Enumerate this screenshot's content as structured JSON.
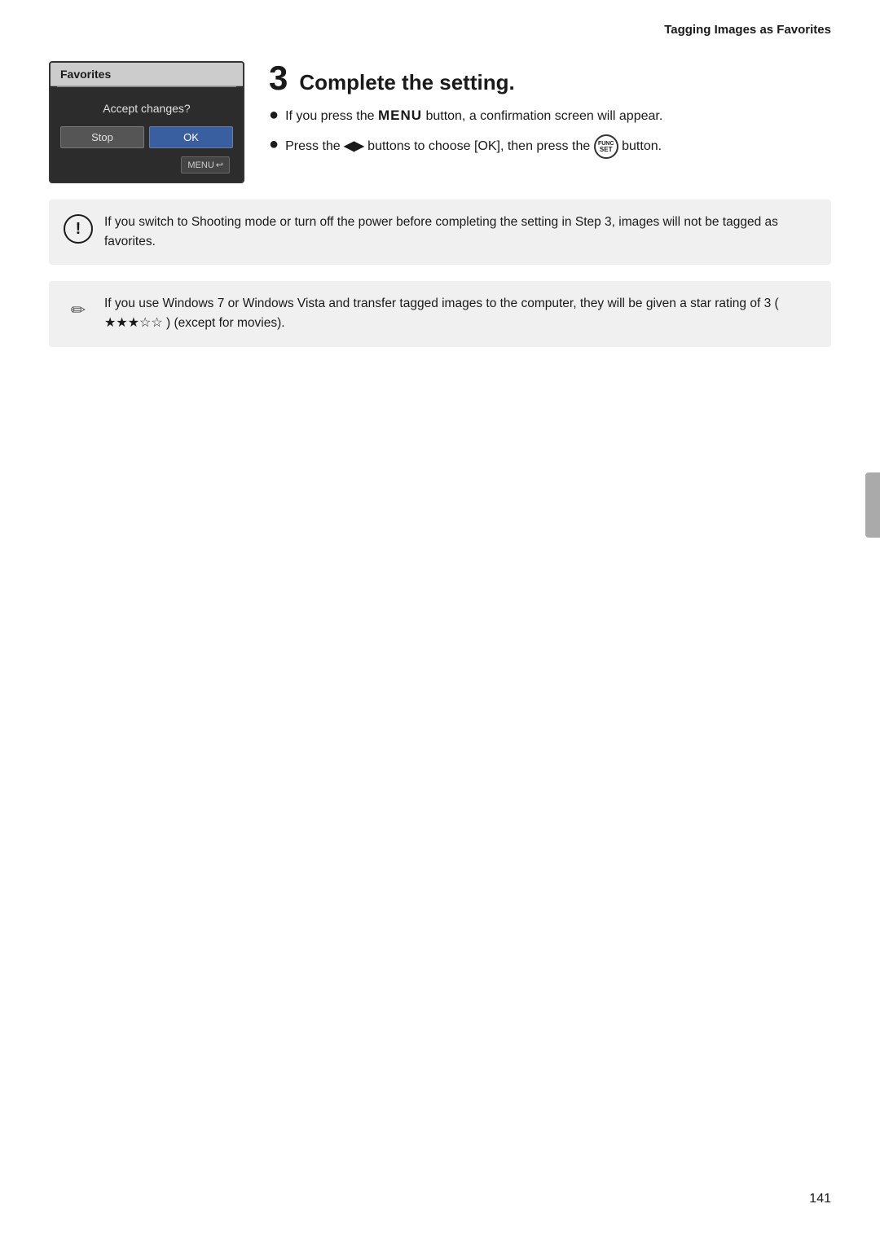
{
  "header": {
    "title": "Tagging Images as Favorites"
  },
  "step": {
    "number": "3",
    "title": "Complete the setting.",
    "bullets": [
      {
        "id": "bullet-1",
        "text_before": "If you press the ",
        "menu_label": "MENU",
        "text_after": " button, a confirmation screen will appear."
      },
      {
        "id": "bullet-2",
        "text_before": "Press the ",
        "arrow_symbol": "◀▶",
        "text_middle": " buttons to choose [OK], then press the ",
        "func_set_top": "FUNC",
        "func_set_bottom": "SET",
        "text_after": " button."
      }
    ]
  },
  "camera_screen": {
    "menu_title": "Favorites",
    "question": "Accept changes?",
    "btn_stop": "Stop",
    "btn_ok": "OK",
    "menu_back": "MENU"
  },
  "notices": [
    {
      "id": "notice-warning",
      "icon_type": "warning",
      "icon_symbol": "!",
      "text": "If you switch to Shooting mode or turn off the power before completing the setting in Step 3, images will not be tagged as favorites."
    },
    {
      "id": "notice-info",
      "icon_type": "pencil",
      "icon_symbol": "✏",
      "text": "If you use Windows 7 or Windows Vista and transfer tagged images to the computer, they will be given a star rating of 3 ( ★★★☆☆ ) (except for movies)."
    }
  ],
  "page_number": "141"
}
